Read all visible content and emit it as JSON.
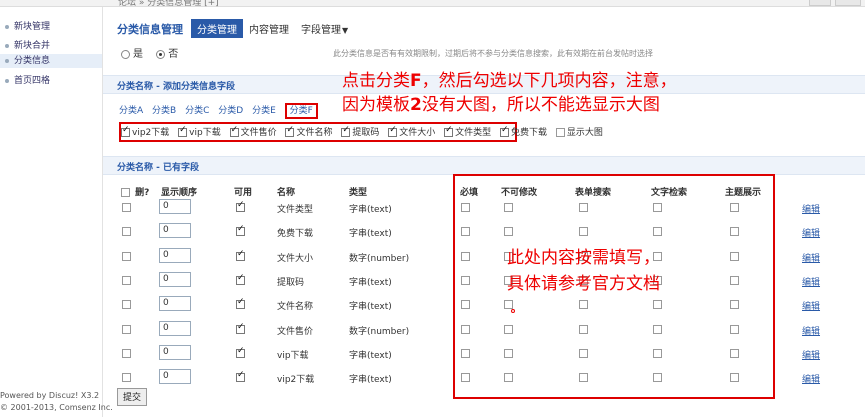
{
  "topbar": {
    "breadcrumb": "论坛 » 分类信息管理 [+]"
  },
  "sidebar": {
    "items": [
      {
        "label": "新块管理",
        "active": false
      },
      {
        "label": "新块合并",
        "active": false
      },
      {
        "label": "分类信息",
        "active": true
      },
      {
        "label": "首页四格",
        "active": false
      }
    ],
    "footer": [
      "Powered by Discuz! X3.2",
      "© 2001-2013, Comsenz Inc."
    ]
  },
  "header": {
    "title": "分类信息管理",
    "tabs": [
      {
        "label": "分类管理",
        "active": true
      },
      {
        "label": "内容管理",
        "active": false
      },
      {
        "label": "字段管理",
        "active": false,
        "dropdown": true
      }
    ]
  },
  "validity": {
    "options": [
      {
        "label": "是",
        "checked": false
      },
      {
        "label": "否",
        "checked": true
      }
    ],
    "note": "此分类信息是否有有效期限制，过期后将不参与分类信息搜索，此有效期在前台发帖时选择"
  },
  "add_section": {
    "title": "分类名称 - 添加分类信息字段",
    "categories": [
      {
        "label": "分类A",
        "selected": false
      },
      {
        "label": "分类B",
        "selected": false
      },
      {
        "label": "分类C",
        "selected": false
      },
      {
        "label": "分类D",
        "selected": false
      },
      {
        "label": "分类E",
        "selected": false
      },
      {
        "label": "分类F",
        "selected": true
      }
    ],
    "fields": [
      {
        "label": "vip2下载",
        "checked": true
      },
      {
        "label": "vip下载",
        "checked": true
      },
      {
        "label": "文件售价",
        "checked": true
      },
      {
        "label": "文件名称",
        "checked": true
      },
      {
        "label": "提取码",
        "checked": true
      },
      {
        "label": "文件大小",
        "checked": true
      },
      {
        "label": "文件类型",
        "checked": true
      },
      {
        "label": "免费下载",
        "checked": true
      },
      {
        "label": "显示大图",
        "checked": false
      }
    ]
  },
  "annotation_top": {
    "line1_prefix": "点击分类",
    "line1_bold": "F",
    "line1_suffix": "，然后勾选以下几项内容，注意，",
    "line2_prefix": "因为模板",
    "line2_bold": "2",
    "line2_suffix": "没有大图，所以不能选显示大图"
  },
  "existing_section": {
    "title": "分类名称 - 已有字段"
  },
  "table": {
    "headers": {
      "delete": "删?",
      "order": "显示顺序",
      "enabled": "可用",
      "name": "名称",
      "type": "类型",
      "required": "必填",
      "unchangeable": "不可修改",
      "form_search": "表单搜索",
      "text_search": "文字检索",
      "subject_display": "主题展示"
    },
    "edit_label": "编辑",
    "rows": [
      {
        "order": "0",
        "name": "文件类型",
        "type": "字串(text)"
      },
      {
        "order": "0",
        "name": "免费下载",
        "type": "字串(text)"
      },
      {
        "order": "0",
        "name": "文件大小",
        "type": "数字(number)"
      },
      {
        "order": "0",
        "name": "提取码",
        "type": "字串(text)"
      },
      {
        "order": "0",
        "name": "文件名称",
        "type": "字串(text)"
      },
      {
        "order": "0",
        "name": "文件售价",
        "type": "数字(number)"
      },
      {
        "order": "0",
        "name": "vip下载",
        "type": "字串(text)"
      },
      {
        "order": "0",
        "name": "vip2下载",
        "type": "字串(text)"
      }
    ]
  },
  "annotation_mid": {
    "line1": "此处内容按需填写，",
    "line2": "具体请参考官方文档"
  },
  "submit_label": "提交",
  "colors": {
    "link": "#2a5aa8",
    "annotation": "#dd0000",
    "section_bg": "#eef3fa"
  }
}
